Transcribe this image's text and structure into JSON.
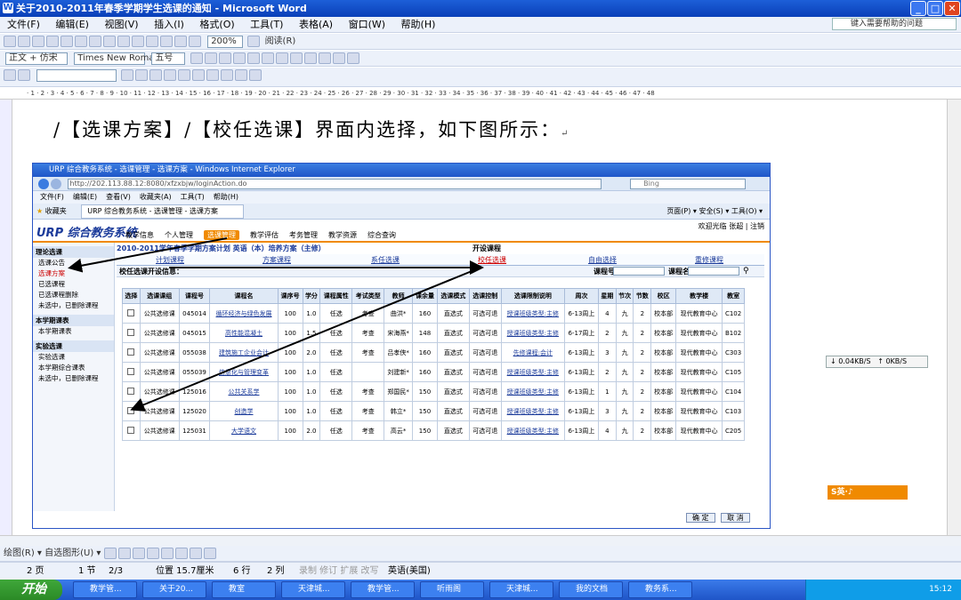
{
  "window": {
    "title": "关于2010-2011年春季学期学生选课的通知 - Microsoft Word",
    "help_placeholder": "键入需要帮助的问题"
  },
  "menu": [
    "文件(F)",
    "编辑(E)",
    "视图(V)",
    "插入(I)",
    "格式(O)",
    "工具(T)",
    "表格(A)",
    "窗口(W)",
    "帮助(H)"
  ],
  "toolbar": {
    "zoom": "200%",
    "read": "阅读(R)",
    "style": "正文 + 仿宋",
    "font": "Times New Roman",
    "size": "五号"
  },
  "doc": {
    "heading": "/【选课方案】/【校任选课】界面内选择，如下图所示：",
    "para_mark": "↵"
  },
  "ie": {
    "title": "URP 综合教务系统 - 选课管理 - 选课方案 - Windows Internet Explorer",
    "url": "http://202.113.88.12:8080/xfzxbjw/loginAction.do",
    "search": "Bing",
    "menu": [
      "文件(F)",
      "编辑(E)",
      "查看(V)",
      "收藏夹(A)",
      "工具(T)",
      "帮助(H)"
    ],
    "fav_label": "收藏夹",
    "tab_label": "URP 综合教务系统 - 选课管理 - 选课方案",
    "fav_tools": "页面(P) ▾  安全(S) ▾  工具(O) ▾"
  },
  "urp": {
    "logo": "URP 综合教务系统",
    "nav": [
      "教学信息",
      "个人管理",
      "选课管理",
      "教学评估",
      "考务管理",
      "教学资源",
      "综合查询"
    ],
    "nav_active": "选课管理",
    "user": "欢迎光临 张超 | 注销",
    "side": {
      "h1": "理论选课",
      "items1": [
        "选课公告",
        "选课方案",
        "已选课程",
        "已选课程删除",
        "未选中，已删除课程"
      ],
      "h2": "本学期课表",
      "items2": [
        "本学期课表"
      ],
      "h3": "实验选课",
      "items3": [
        "实验选课",
        "本学期综合课表",
        "未选中，已删除课程"
      ]
    },
    "plan_title": "2010-2011学年春季学期方案计划  英语（本）培养方案（主修）",
    "open_course": "开设课程",
    "tabs": [
      "计划课程",
      "方案课程",
      "系任选课",
      "校任选课",
      "自由选择",
      "重修课程"
    ],
    "info": "校任选课开设信息：",
    "search_code": "课程号",
    "search_name": "课程名"
  },
  "table": {
    "headers": [
      "选择",
      "选课课组",
      "课程号",
      "课程名",
      "课序号",
      "学分",
      "课程属性",
      "考试类型",
      "教师",
      "课余量",
      "选课模式",
      "选课控制",
      "选课限制说明",
      "周次",
      "星期",
      "节次",
      "节数",
      "校区",
      "教学楼",
      "教室"
    ],
    "rows": [
      [
        "公共选修课",
        "045014",
        "循环经济与绿色发展",
        "100",
        "1.0",
        "任选",
        "考查",
        "曲洪*",
        "160",
        "直选式",
        "可选可退",
        "授课班级类型:主修",
        "6-13周上",
        "4",
        "九",
        "2",
        "校本部",
        "现代教育中心",
        "C102"
      ],
      [
        "公共选修课",
        "045015",
        "高性能混凝土",
        "100",
        "1.5",
        "任选",
        "考查",
        "宋海燕*",
        "148",
        "直选式",
        "可选可退",
        "授课班级类型:主修",
        "6-17周上",
        "2",
        "九",
        "2",
        "校本部",
        "现代教育中心",
        "B102"
      ],
      [
        "公共选修课",
        "055038",
        "建筑施工企业会计",
        "100",
        "2.0",
        "任选",
        "考查",
        "吕孝侠*",
        "160",
        "直选式",
        "可选可退",
        "先修课程:会计",
        "6-13周上",
        "3",
        "九",
        "2",
        "校本部",
        "现代教育中心",
        "C303"
      ],
      [
        "公共选修课",
        "055039",
        "信息化与管理变革",
        "100",
        "1.0",
        "任选",
        "",
        "刘建新*",
        "160",
        "直选式",
        "可选可退",
        "授课班级类型:主修",
        "6-13周上",
        "2",
        "九",
        "2",
        "校本部",
        "现代教育中心",
        "C105"
      ],
      [
        "公共选修课",
        "125016",
        "公共关系学",
        "100",
        "1.0",
        "任选",
        "考查",
        "郑国民*",
        "150",
        "直选式",
        "可选可退",
        "授课班级类型:主修",
        "6-13周上",
        "1",
        "九",
        "2",
        "校本部",
        "现代教育中心",
        "C104"
      ],
      [
        "公共选修课",
        "125020",
        "创造学",
        "100",
        "1.0",
        "任选",
        "考查",
        "韩立*",
        "150",
        "直选式",
        "可选可退",
        "授课班级类型:主修",
        "6-13周上",
        "3",
        "九",
        "2",
        "校本部",
        "现代教育中心",
        "C103"
      ],
      [
        "公共选修课",
        "125031",
        "大学语文",
        "100",
        "2.0",
        "任选",
        "考查",
        "高云*",
        "150",
        "直选式",
        "可选可退",
        "授课班级类型:主修",
        "6-13周上",
        "4",
        "九",
        "2",
        "校本部",
        "现代教育中心",
        "C205"
      ]
    ]
  },
  "ie_buttons": {
    "ok": "确 定",
    "cancel": "取 消"
  },
  "net": {
    "down": "0.04KB/S",
    "up": "0KB/S"
  },
  "sogou": "S英·♪",
  "status": {
    "page": "2 页",
    "section": "1 节",
    "pages": "2/3",
    "pos": "位置 15.7厘米",
    "line": "6 行",
    "col": "2 列",
    "modes": "录制  修订  扩展  改写",
    "lang": "英语(美国)"
  },
  "drawbar": "绘图(R) ▾   自选图形(U) ▾",
  "taskbar": {
    "start": "开始",
    "tasks": [
      "教学管...",
      "关于20...",
      "教室",
      "天津城...",
      "教学管...",
      "听雨阁",
      "天津城...",
      "我的文档",
      "教务系..."
    ],
    "time": "15:12"
  },
  "colors": {
    "accent": "#f08a00",
    "title_blue": "#1d5fd8",
    "link": "#1a3a9a"
  }
}
